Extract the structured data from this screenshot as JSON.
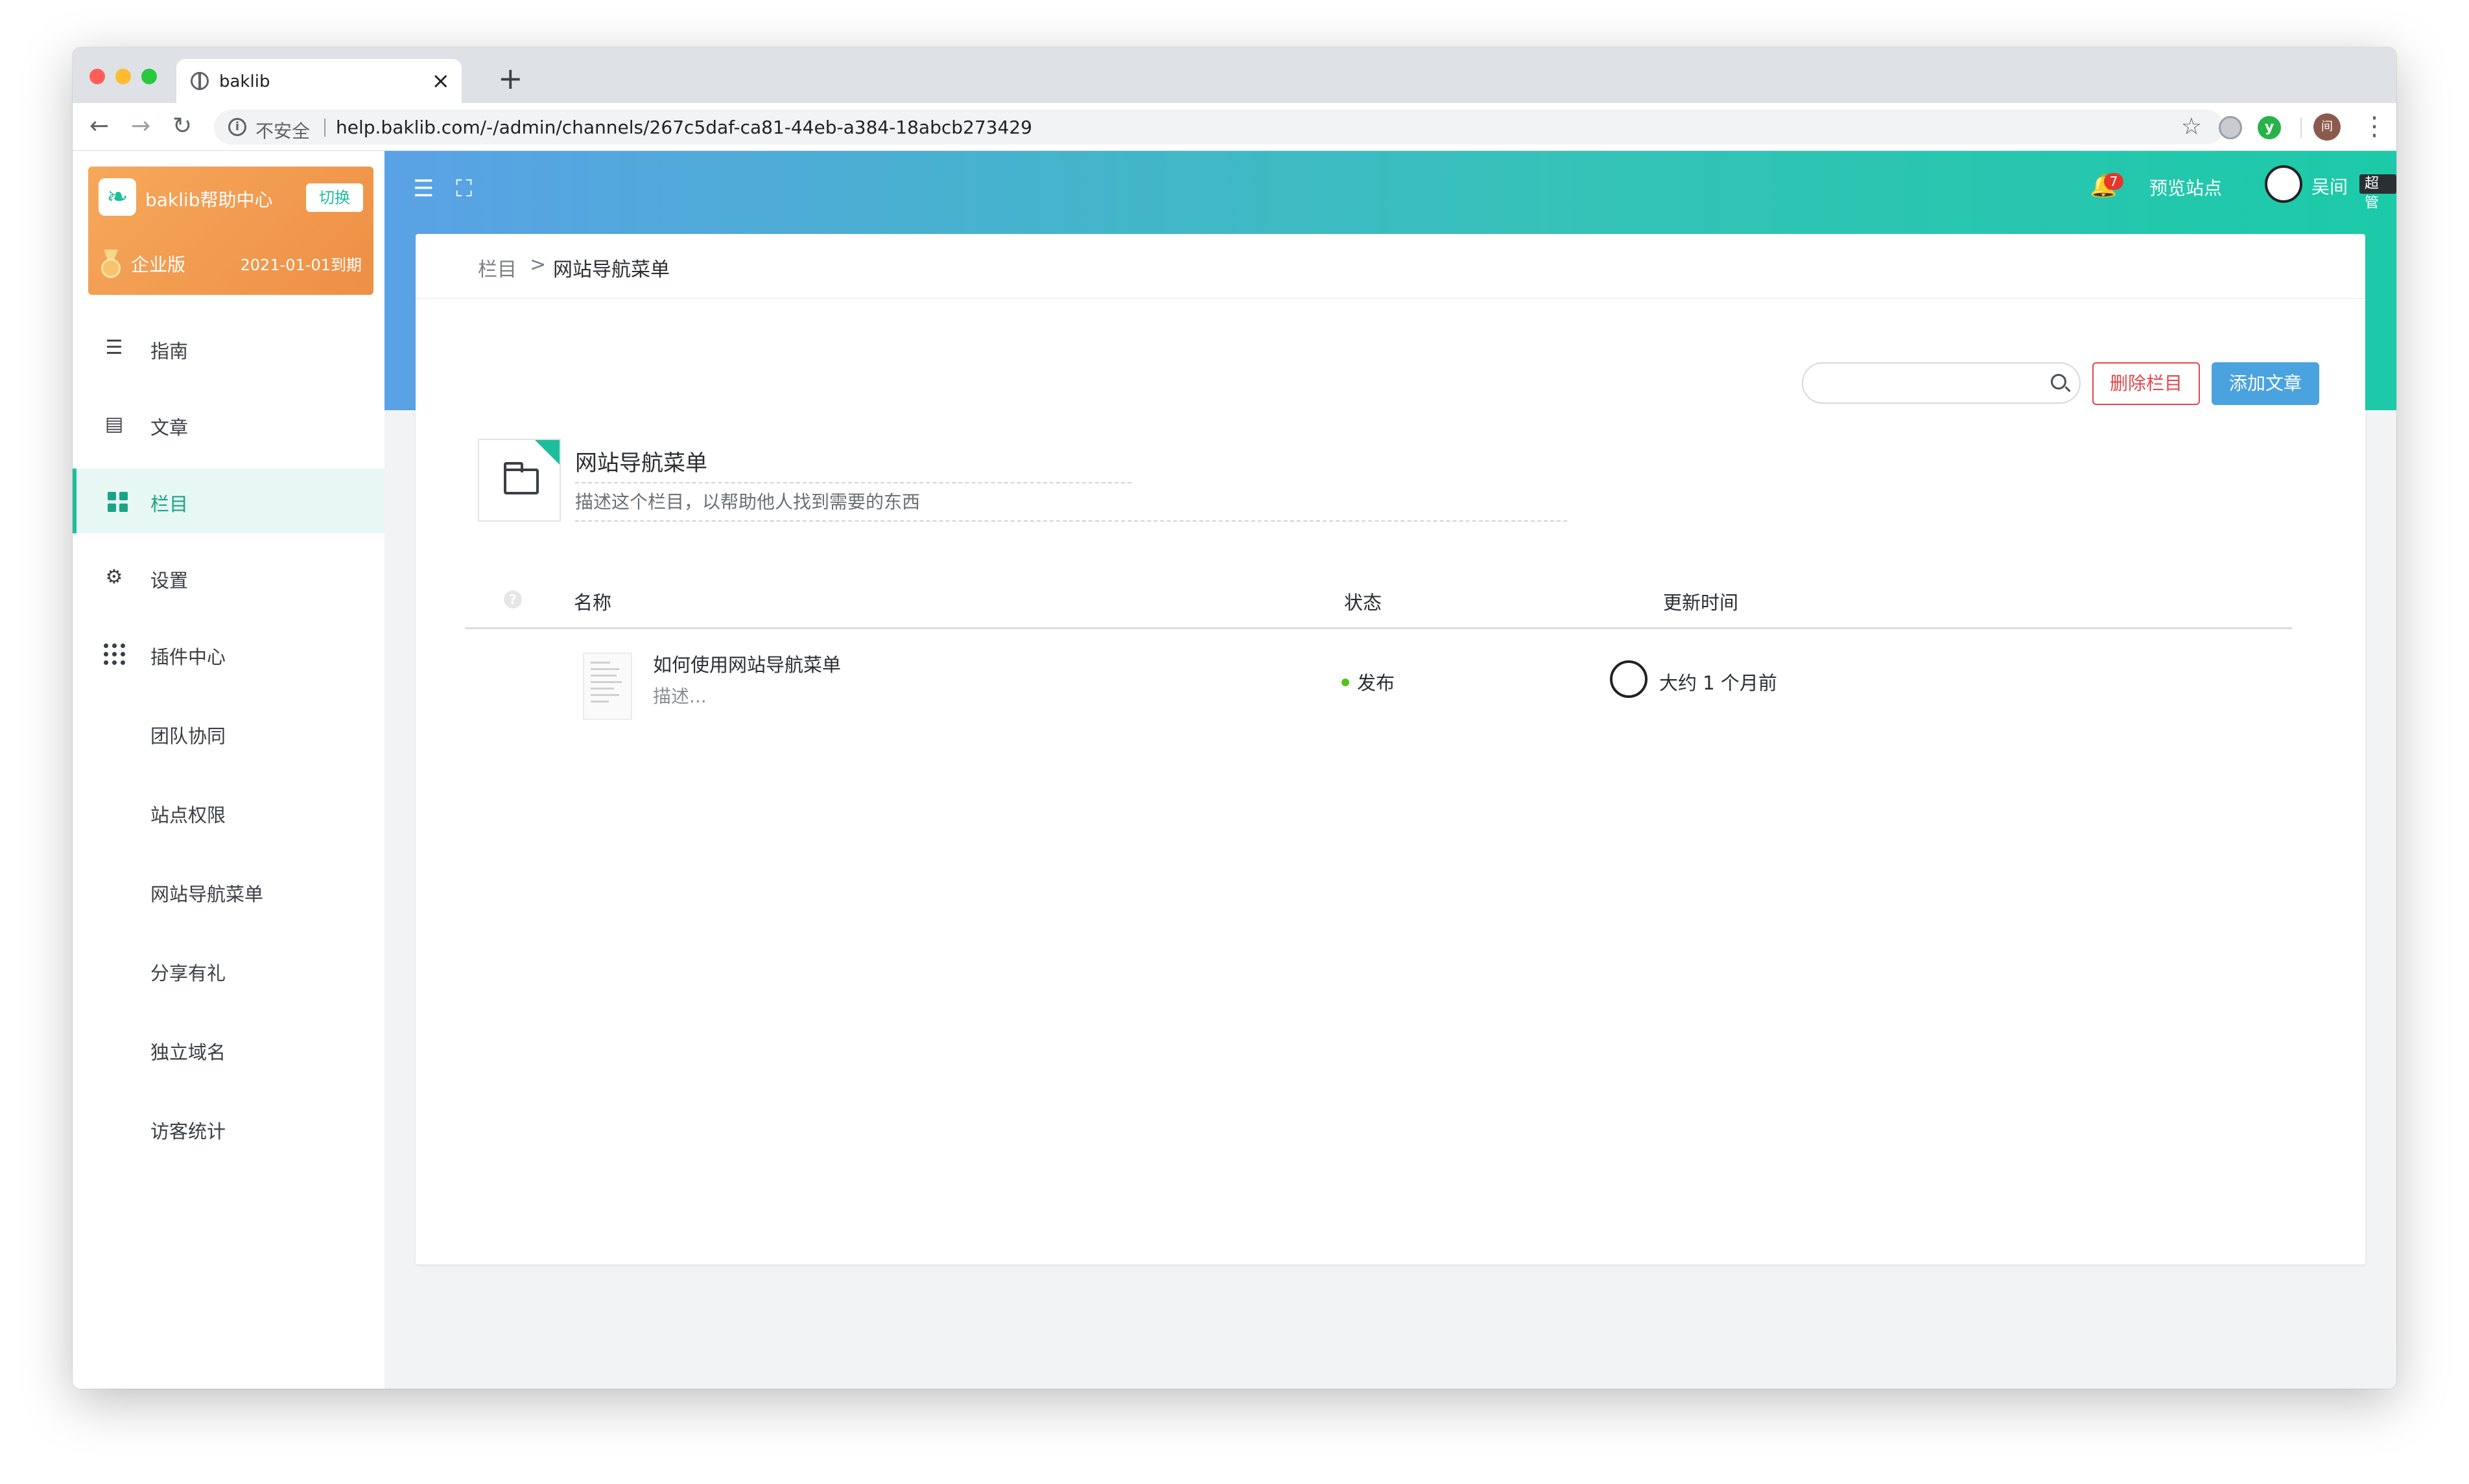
{
  "browser": {
    "tab_title": "baklib",
    "tab_close": "×",
    "new_tab": "+",
    "insecure_label": "不安全",
    "url": "help.baklib.com/-/admin/channels/267c5daf-ca81-44eb-a384-18abcb273429",
    "profile_initial": "间",
    "ext_badge": "y"
  },
  "brand": {
    "name": "baklib帮助中心",
    "switch_label": "切换",
    "edition": "企业版",
    "expire": "2021-01-01到期"
  },
  "sidebar": {
    "items": [
      {
        "label": "指南",
        "icon": "signpost-icon"
      },
      {
        "label": "文章",
        "icon": "article-icon"
      },
      {
        "label": "栏目",
        "icon": "grid-icon",
        "active": true
      },
      {
        "label": "设置",
        "icon": "gear-icon"
      },
      {
        "label": "插件中心",
        "icon": "apps-icon"
      }
    ],
    "sub_items": [
      "团队协同",
      "站点权限",
      "网站导航菜单",
      "分享有礼",
      "独立域名",
      "访客统计"
    ]
  },
  "header": {
    "notification_count": "7",
    "preview_site": "预览站点",
    "user_name": "吴间",
    "role": "超管"
  },
  "breadcrumb": {
    "parent": "栏目",
    "separator": ">",
    "current": "网站导航菜单"
  },
  "toolbar": {
    "search_placeholder": "",
    "delete_label": "删除栏目",
    "add_label": "添加文章"
  },
  "channel": {
    "title": "网站导航菜单",
    "description": "描述这个栏目，以帮助他人找到需要的东西"
  },
  "table": {
    "help": "?",
    "columns": [
      "名称",
      "状态",
      "更新时间"
    ],
    "rows": [
      {
        "title": "如何使用网站导航菜单",
        "description": "描述...",
        "status": "发布",
        "status_color": "#52c41a",
        "updated": "大约 1 个月前"
      }
    ]
  },
  "colors": {
    "accent": "#1cbf9b",
    "primary_button": "#4aa3df",
    "danger": "#e0474c"
  }
}
